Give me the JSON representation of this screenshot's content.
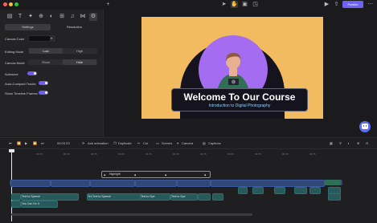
{
  "sidebar": {
    "tabs": [
      {
        "label": "Settings"
      },
      {
        "label": "Resolution"
      }
    ],
    "canvas_color_label": "Canvas Color",
    "editing_mode": {
      "label": "Editing Mode",
      "options": [
        "Low",
        "High"
      ]
    },
    "canvas_mode": {
      "label": "Canvas Mode",
      "options": [
        "Show",
        "Hide"
      ]
    },
    "autosave_label": "Autosave",
    "auto_compact_label": "Auto-Compact Tracks",
    "show_timeline_frames_label": "Show Timeline Frames"
  },
  "toolbar": {
    "publish_label": "Publish"
  },
  "slide": {
    "title": "Welcome To Our Course",
    "subtitle": "Introduction to Digital Photography",
    "background_color": "#f3bb5f",
    "arch_color": "#15131e",
    "circle_color": "#a46cf0"
  },
  "timeline": {
    "timecode": "00:03.23",
    "buttons": [
      "Add animation",
      "Duplicate",
      "Cut",
      "Scenes",
      "Camera",
      "Captions"
    ],
    "ruler": [
      "00:15",
      "00:30",
      "00:45",
      "01:00",
      "01:15",
      "01:30",
      "01:45",
      "02:00",
      "02:15",
      "02:30",
      "02:45"
    ],
    "clips": {
      "text_label": "Highlight",
      "speech": "Text to Speech",
      "speech_short": "Text to Spe",
      "you_can_do": "You Can Do It"
    }
  }
}
